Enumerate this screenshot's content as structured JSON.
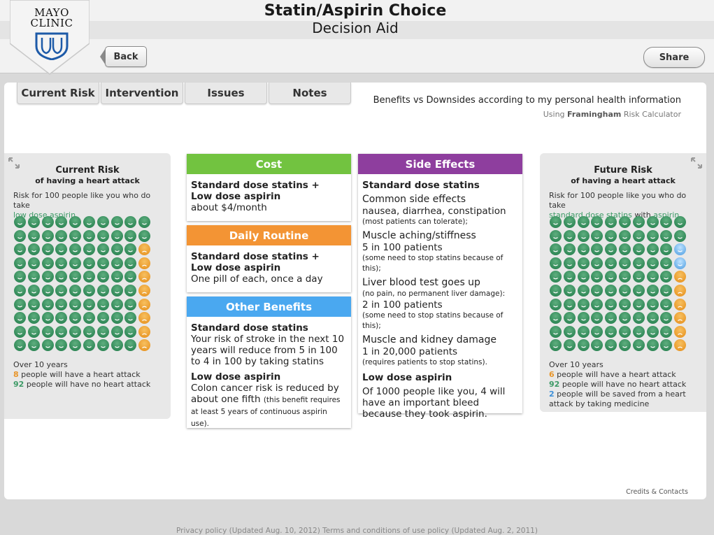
{
  "header": {
    "logo_line1": "MAYO",
    "logo_line2": "CLINIC",
    "title": "Statin/Aspirin Choice",
    "subtitle": "Decision Aid",
    "back_label": "Back",
    "share_label": "Share"
  },
  "tabs": [
    {
      "label": "Current Risk"
    },
    {
      "label": "Intervention"
    },
    {
      "label": "Issues"
    },
    {
      "label": "Notes"
    }
  ],
  "info": {
    "heading": "Benefits vs Downsides according to my personal health information",
    "using_prefix": "Using",
    "using_calc": "Framingham",
    "using_suffix": "Risk Calculator"
  },
  "current_risk": {
    "title": "Current Risk",
    "subtitle": "of having a heart attack",
    "desc": "Risk for 100 people like you who do take",
    "treatment": "low dose aspirin",
    "over": "Over 10 years",
    "heart_count": "8",
    "heart_text": "people will have a heart attack",
    "no_count": "92",
    "no_text": "people will have no heart attack",
    "faces": {
      "sad": 8,
      "saved": 0,
      "total": 100
    }
  },
  "future_risk": {
    "title": "Future Risk",
    "subtitle": "of having a heart attack",
    "desc": "Risk for 100 people like you who do take",
    "treatment1": "standard dose statins",
    "with": "with",
    "treatment2": "aspirin",
    "over": "Over 10 years",
    "heart_count": "6",
    "heart_text": "people will have a heart attack",
    "no_count": "92",
    "no_text": "people will have no heart attack",
    "saved_count": "2",
    "saved_text": "people will be saved from a heart attack by taking medicine",
    "faces": {
      "sad": 6,
      "saved": 2,
      "total": 100
    }
  },
  "cards": {
    "cost": {
      "title": "Cost",
      "line1": "Standard dose statins +",
      "line2": "Low dose aspirin",
      "line3": "about $4/month"
    },
    "daily": {
      "title": "Daily Routine",
      "line1": "Standard dose statins +",
      "line2": "Low dose aspirin",
      "line3": "One pill of each, once a day"
    },
    "other": {
      "title": "Other Benefits",
      "h1": "Standard dose statins",
      "p1": "Your risk of stroke in the next 10 years will reduce from 5 in 100 to 4 in 100 by taking statins",
      "h2": "Low dose aspirin",
      "p2": "Colon cancer risk is reduced by about one fifth",
      "p2_small": "(this benefit requires at least 5 years of continuous aspirin use)."
    },
    "side": {
      "title": "Side Effects",
      "h1": "Standard dose statins",
      "i1_t": "Common side effects",
      "i1_a": "nausea, diarrhea, constipation",
      "i1_s": "(most patients can tolerate);",
      "i2_t": "Muscle aching/stiffness",
      "i2_a": "5 in 100 patients",
      "i2_s": "(some need to stop statins because of this);",
      "i3_t": "Liver blood test goes up",
      "i3_s1": "(no pain, no permanent liver damage):",
      "i3_a": "2 in 100 patients",
      "i3_s2": "(some need to stop statins because of this);",
      "i4_t": "Muscle and kidney damage",
      "i4_a": "1 in 20,000 patients",
      "i4_s": "(requires patients to stop statins).",
      "h2": "Low dose aspirin",
      "p2": "Of 1000 people like you, 4 will have an important bleed because they took aspirin."
    }
  },
  "credits": "Credits & Contacts",
  "footer": "Privacy policy (Updated Aug. 10, 2012) Terms and conditions of use policy (Updated Aug. 2, 2011)"
}
